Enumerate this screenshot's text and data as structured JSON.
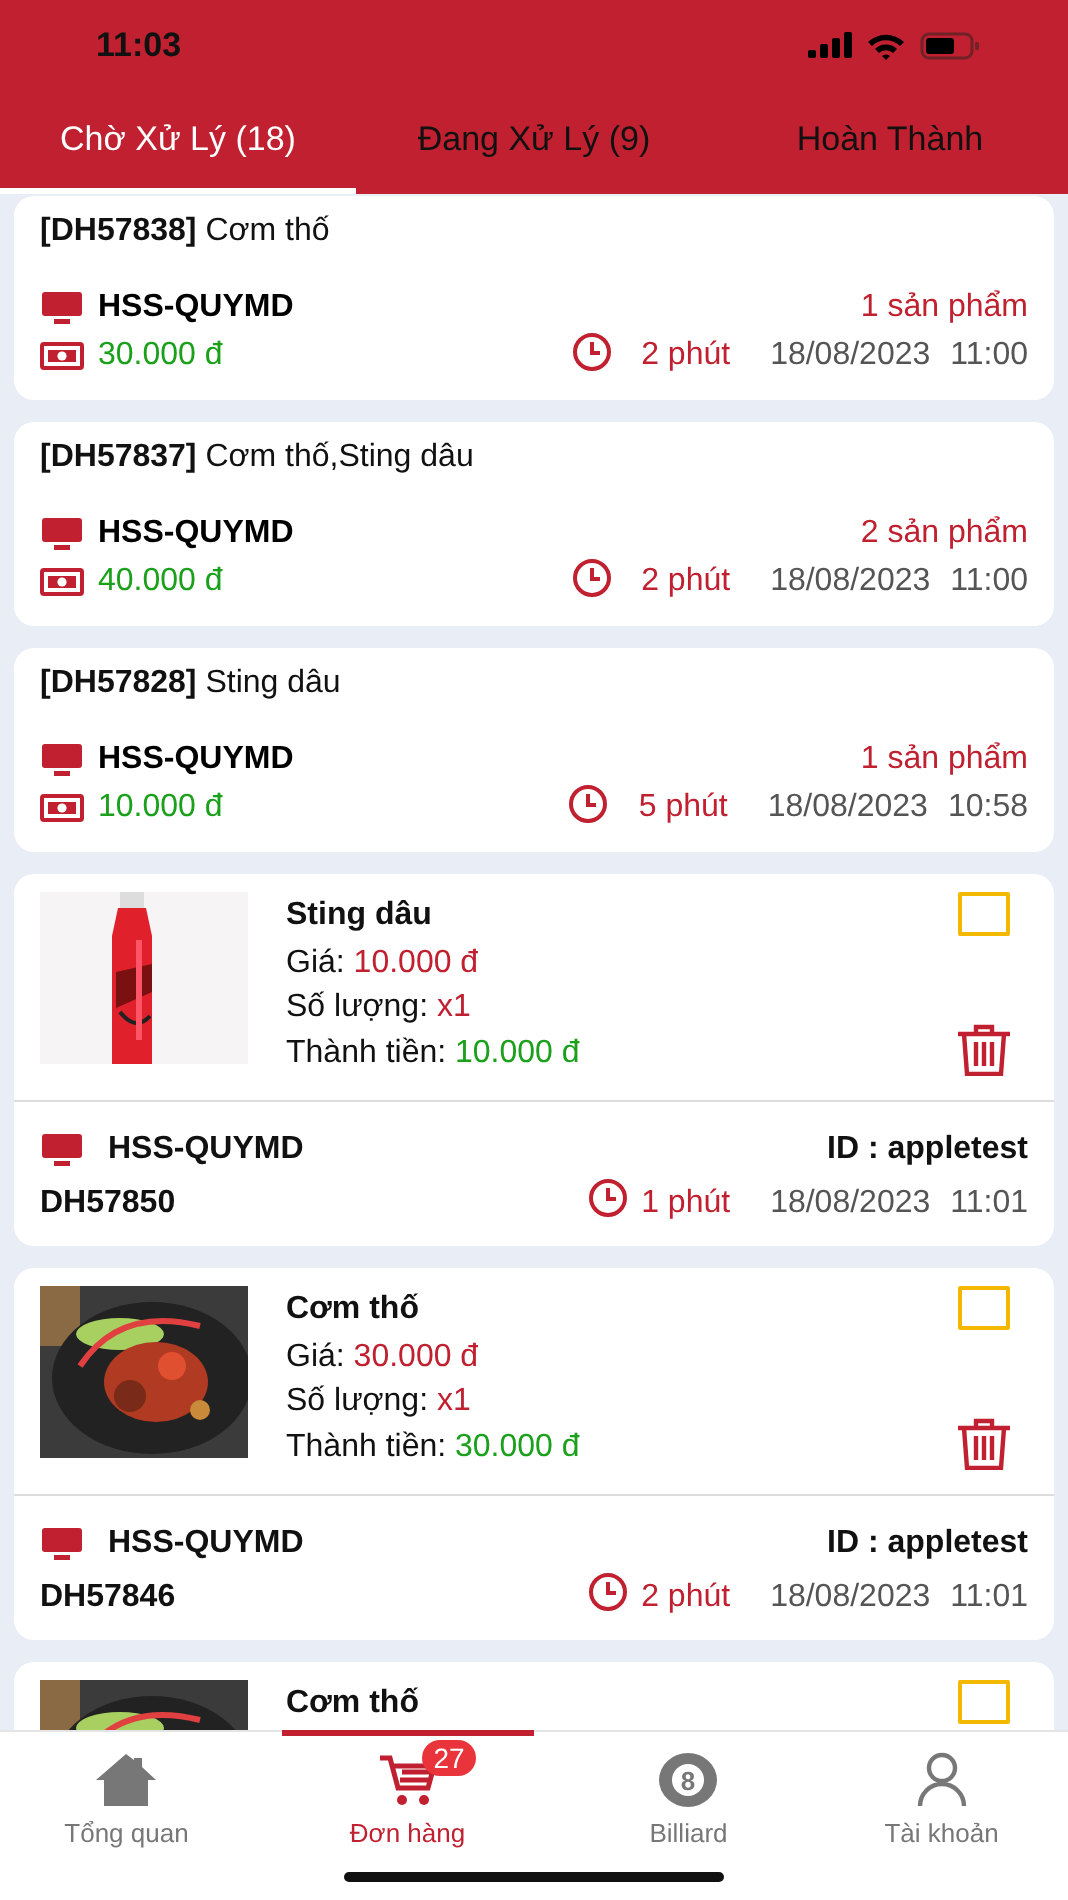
{
  "status_bar": {
    "time": "11:03"
  },
  "tabs": [
    {
      "label": "Chờ Xử Lý (18)",
      "selected": true
    },
    {
      "label": "Đang Xử Lý (9)",
      "selected": false
    },
    {
      "label": "Hoàn Thành",
      "selected": false
    }
  ],
  "orders": [
    {
      "code": "[DH57838]",
      "items": "Cơm thố",
      "device": "HSS-QUYMD",
      "count": "1 sản phẩm",
      "total": "30.000 đ",
      "elapsed": "2 phút",
      "date": "18/08/2023",
      "time": "11:00"
    },
    {
      "code": "[DH57837]",
      "items": "Cơm thố,Sting dâu",
      "device": "HSS-QUYMD",
      "count": "2 sản phẩm",
      "total": "40.000 đ",
      "elapsed": "2 phút",
      "date": "18/08/2023",
      "time": "11:00"
    },
    {
      "code": "[DH57828]",
      "items": "Sting dâu",
      "device": "HSS-QUYMD",
      "count": "1 sản phẩm",
      "total": "10.000 đ",
      "elapsed": "5 phút",
      "date": "18/08/2023",
      "time": "10:58"
    }
  ],
  "line_items": [
    {
      "name": "Sting dâu",
      "checked": false,
      "price_label": "Giá:",
      "price": "10.000 đ",
      "qty_label": "Số lượng:",
      "qty": "x1",
      "total_label": "Thành tiền:",
      "total": "10.000 đ",
      "device": "HSS-QUYMD",
      "user": "ID : appletest",
      "code": "DH57850",
      "elapsed": "1 phút",
      "date": "18/08/2023",
      "time": "11:01"
    },
    {
      "name": "Cơm thố",
      "checked": false,
      "price_label": "Giá:",
      "price": "30.000 đ",
      "qty_label": "Số lượng:",
      "qty": "x1",
      "total_label": "Thành tiền:",
      "total": "30.000 đ",
      "device": "HSS-QUYMD",
      "user": "ID : appletest",
      "code": "DH57846",
      "elapsed": "2 phút",
      "date": "18/08/2023",
      "time": "11:01"
    },
    {
      "name": "Cơm thố",
      "checked": false
    }
  ],
  "nav": [
    {
      "kind": "home",
      "label": "Tổng quan",
      "selected": false
    },
    {
      "kind": "cart",
      "label": "Đơn hàng",
      "selected": true,
      "badge": "27"
    },
    {
      "kind": "ball",
      "label": "Billiard",
      "selected": false,
      "icon_text": "8"
    },
    {
      "kind": "person",
      "label": "Tài khoản",
      "selected": false
    }
  ]
}
